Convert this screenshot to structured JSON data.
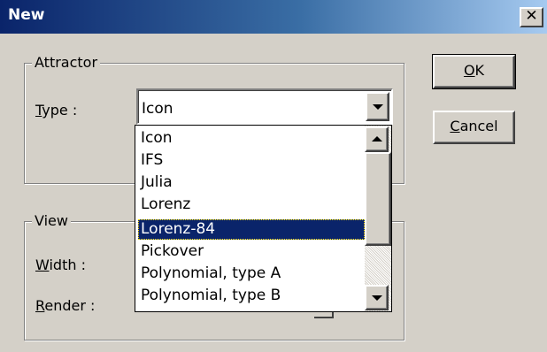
{
  "window": {
    "title": "New",
    "close_glyph": "✕"
  },
  "attractor": {
    "legend": "Attractor",
    "type_label_first": "T",
    "type_label_rest": "ype :",
    "type_value": "Icon"
  },
  "view": {
    "legend": "View",
    "width_label_first": "W",
    "width_label_rest": "idth :",
    "render_label_first": "R",
    "render_label_rest": "ender :"
  },
  "buttons": {
    "ok_first": "O",
    "ok_rest": "K",
    "cancel_first": "C",
    "cancel_rest": "ancel"
  },
  "dropdown": {
    "options": [
      "Icon",
      "IFS",
      "Julia",
      "Lorenz",
      "Lorenz-84",
      "Pickover",
      "Polynomial, type A",
      "Polynomial, type B"
    ],
    "selected_index": 4
  },
  "icons": {
    "close": "close-icon",
    "combo_arrow": "chevron-down-icon",
    "scroll_up": "scroll-up-icon",
    "scroll_down": "scroll-down-icon"
  },
  "colors": {
    "titlebar_start": "#0a246a",
    "titlebar_end": "#a6caf0",
    "dialog_face": "#d4d0c8",
    "selection": "#0a246a"
  }
}
